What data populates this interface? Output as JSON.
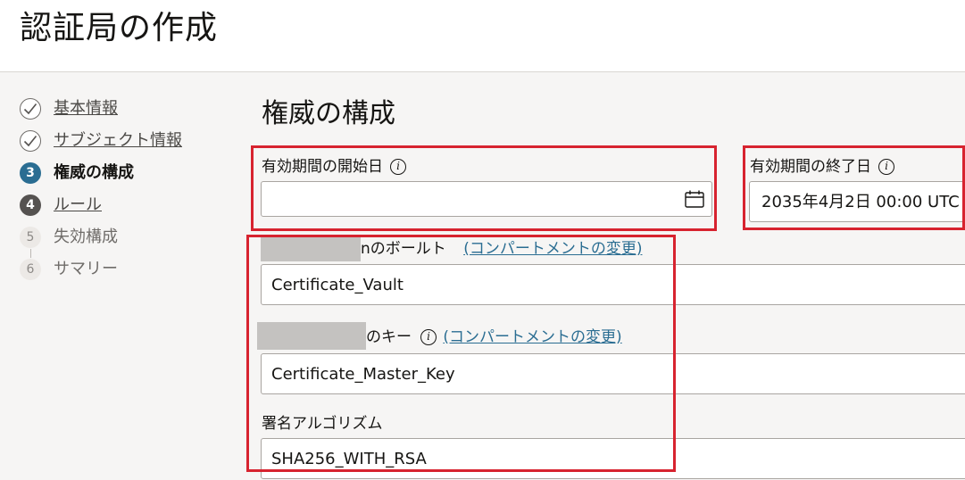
{
  "header": {
    "title": "認証局の作成"
  },
  "steps": [
    {
      "number": "1",
      "label": "基本情報",
      "state": "done"
    },
    {
      "number": "2",
      "label": "サブジェクト情報",
      "state": "done"
    },
    {
      "number": "3",
      "label": "権威の構成",
      "state": "current"
    },
    {
      "number": "4",
      "label": "ルール",
      "state": "next"
    },
    {
      "number": "5",
      "label": "失効構成",
      "state": "future"
    },
    {
      "number": "6",
      "label": "サマリー",
      "state": "future"
    }
  ],
  "main": {
    "section_title": "権威の構成",
    "validity_start": {
      "label": "有効期間の開始日",
      "value": "",
      "icon": "calendar-icon"
    },
    "validity_end": {
      "label": "有効期間の終了日",
      "value": "2035年4月2日 00:00 UTC"
    },
    "vault": {
      "label_suffix": "nのボールト",
      "change_link": "(コンパートメントの変更)",
      "value": "Certificate_Vault"
    },
    "key": {
      "label_suffix": "のキー",
      "change_link": "(コンパートメントの変更)",
      "value": "Certificate_Master_Key"
    },
    "signing_algorithm": {
      "label": "署名アルゴリズム",
      "value": "SHA256_WITH_RSA"
    }
  },
  "colors": {
    "accent": "#2a6d92",
    "highlight": "#d7232f",
    "background": "#f6f5f4"
  }
}
